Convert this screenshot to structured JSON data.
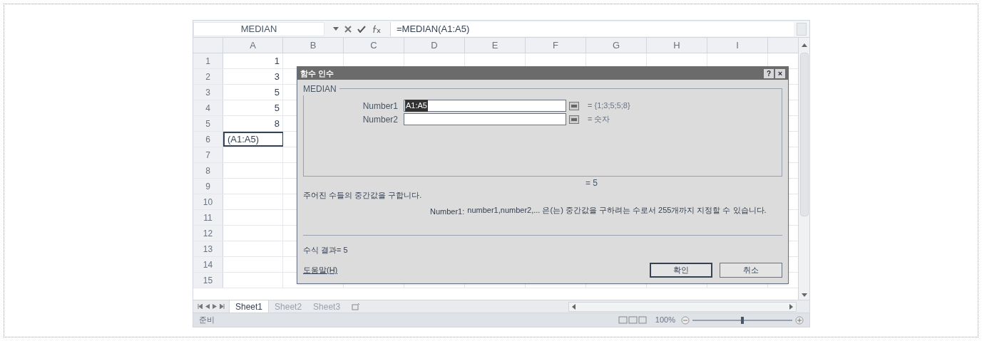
{
  "formula_bar": {
    "name_box": "MEDIAN",
    "formula": "=MEDIAN(A1:A5)"
  },
  "columns": [
    "A",
    "B",
    "C",
    "D",
    "E",
    "F",
    "G",
    "H",
    "I"
  ],
  "rows": [
    {
      "number": "1",
      "a": "1",
      "active": false
    },
    {
      "number": "2",
      "a": "3",
      "active": false
    },
    {
      "number": "3",
      "a": "5",
      "active": false
    },
    {
      "number": "4",
      "a": "5",
      "active": false
    },
    {
      "number": "5",
      "a": "8",
      "active": false
    },
    {
      "number": "6",
      "a": "(A1:A5)",
      "active": true
    },
    {
      "number": "7",
      "active": false
    },
    {
      "number": "8",
      "active": false
    },
    {
      "number": "9",
      "active": false
    },
    {
      "number": "10",
      "active": false
    },
    {
      "number": "11",
      "active": false
    },
    {
      "number": "12",
      "active": false
    },
    {
      "number": "13",
      "active": false
    },
    {
      "number": "14",
      "active": false
    },
    {
      "number": "15",
      "active": false
    }
  ],
  "dialog": {
    "title": "함수 인수",
    "help_glyph": "?",
    "close_glyph": "×",
    "function_name": "MEDIAN",
    "arguments": [
      {
        "label": "Number1",
        "value": "A1:A5",
        "highlighted": true,
        "result": "= {1;3;5;5;8}"
      },
      {
        "label": "Number2",
        "highlighted": false,
        "result": "= 숫자"
      }
    ],
    "result_value": "= 5",
    "description": "주어진 수들의 중간값을 구합니다.",
    "argument_help": {
      "label": "Number1:",
      "text": "number1,number2,... 은(는) 중간값을 구하려는 수로서 255개까지 지정할 수 있습니다."
    },
    "formula_result": "수식 결과= 5",
    "help_link": "도움말(H)",
    "buttons": [
      {
        "label": "확인",
        "default": true
      },
      {
        "label": "취소",
        "default": false
      }
    ]
  },
  "sheet_tabs": [
    {
      "label": "Sheet1",
      "selected": true
    },
    {
      "label": "Sheet2",
      "selected": false
    },
    {
      "label": "Sheet3",
      "selected": false
    }
  ],
  "status_bar": {
    "mode": "준비",
    "zoom": "100%",
    "zoom_slider": {
      "level": 0.5
    }
  }
}
